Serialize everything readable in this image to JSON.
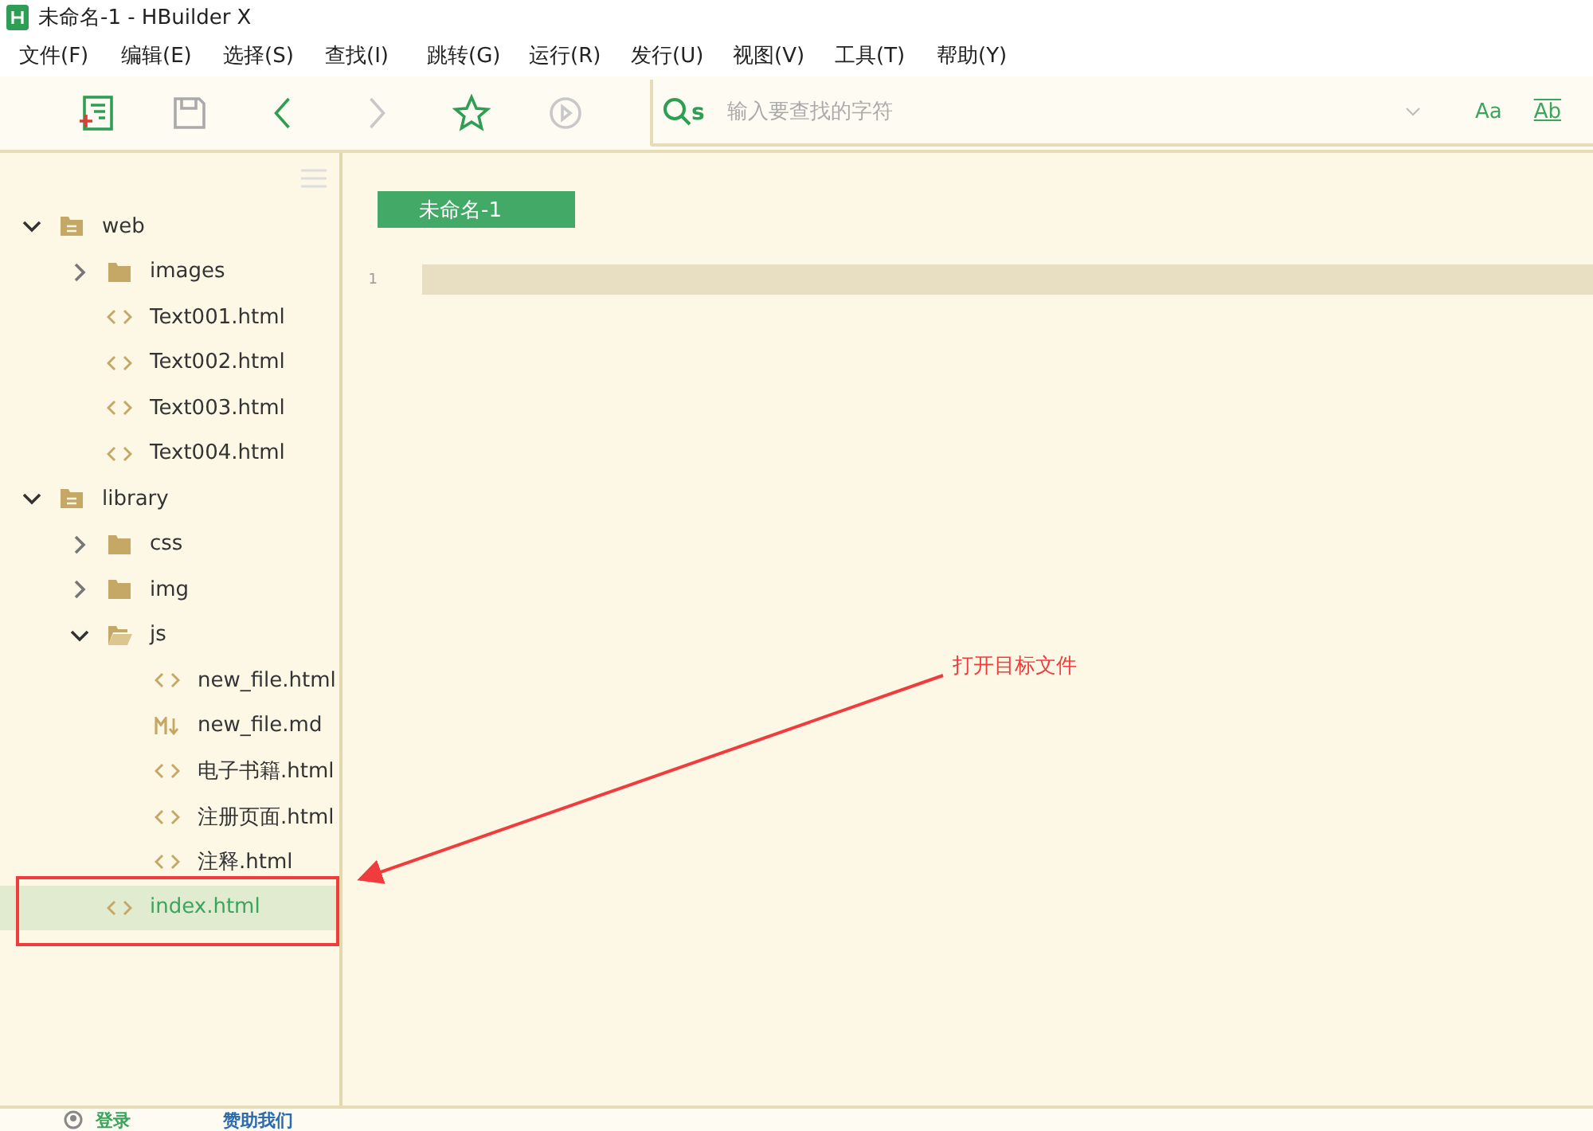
{
  "window": {
    "title": "未命名-1 - HBuilder X"
  },
  "menu": [
    "文件(F)",
    "编辑(E)",
    "选择(S)",
    "查找(I)",
    "跳转(G)",
    "运行(R)",
    "发行(U)",
    "视图(V)",
    "工具(T)",
    "帮助(Y)"
  ],
  "toolbar": [
    {
      "kind": "new-file",
      "disabled": false
    },
    {
      "kind": "save",
      "disabled": true
    },
    {
      "kind": "back",
      "disabled": false
    },
    {
      "kind": "forward",
      "disabled": true
    },
    {
      "kind": "star",
      "disabled": false
    },
    {
      "kind": "run",
      "disabled": true
    }
  ],
  "search": {
    "mode_label": "s",
    "placeholder": "输入要查找的字符",
    "options": [
      "Aa",
      "Ab"
    ]
  },
  "tree": [
    {
      "name": "web",
      "kind": "project",
      "expanded": true,
      "selected": false,
      "children": [
        {
          "name": "images",
          "kind": "folder",
          "expanded": false,
          "selected": false
        },
        {
          "name": "Text001.html",
          "kind": "html",
          "selected": false
        },
        {
          "name": "Text002.html",
          "kind": "html",
          "selected": false
        },
        {
          "name": "Text003.html",
          "kind": "html",
          "selected": false
        },
        {
          "name": "Text004.html",
          "kind": "html",
          "selected": false
        }
      ]
    },
    {
      "name": "library",
      "kind": "project",
      "expanded": true,
      "selected": false,
      "children": [
        {
          "name": "css",
          "kind": "folder",
          "expanded": false,
          "selected": false
        },
        {
          "name": "img",
          "kind": "folder",
          "expanded": false,
          "selected": false
        },
        {
          "name": "js",
          "kind": "folder",
          "expanded": true,
          "selected": false,
          "children": [
            {
              "name": "new_file.html",
              "kind": "html",
              "selected": false
            },
            {
              "name": "new_file.md",
              "kind": "md",
              "selected": false
            },
            {
              "name": "电子书籍.html",
              "kind": "html",
              "selected": false
            },
            {
              "name": "注册页面.html",
              "kind": "html",
              "selected": false
            },
            {
              "name": "注释.html",
              "kind": "html",
              "selected": false
            }
          ]
        },
        {
          "name": "index.html",
          "kind": "html",
          "selected": true
        }
      ]
    }
  ],
  "editor": {
    "tabs": [
      {
        "label": "未命名-1",
        "selected": true
      }
    ],
    "lines": [
      "1"
    ]
  },
  "annotation": {
    "label": "打开目标文件"
  },
  "status_bar": {
    "login": "登录",
    "sponsor": "赞助我们"
  }
}
